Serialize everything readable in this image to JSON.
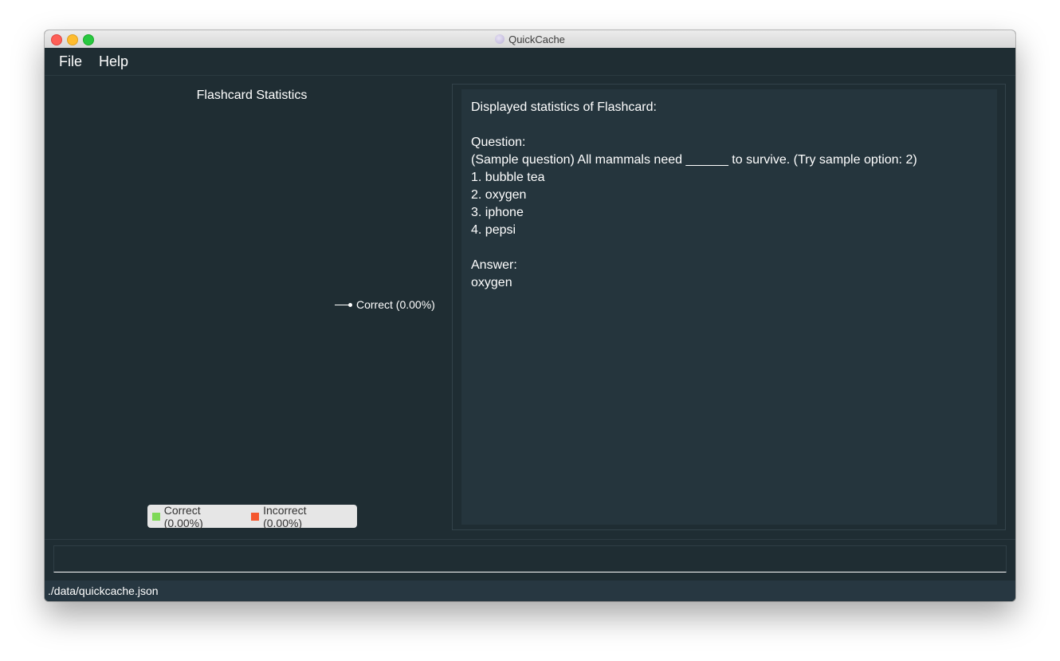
{
  "window": {
    "title": "QuickCache"
  },
  "menu": {
    "items": [
      "File",
      "Help"
    ]
  },
  "stats": {
    "title": "Flashcard Statistics",
    "pie_label": "Correct (0.00%)",
    "legend": [
      {
        "label": "Correct (0.00%)",
        "color": "#7ed957"
      },
      {
        "label": "Incorrect (0.00%)",
        "color": "#f4572e"
      }
    ]
  },
  "flashcard": {
    "heading": "Displayed statistics of Flashcard:",
    "question_label": "Question:",
    "question": "(Sample question) All mammals need ______ to survive. (Try sample option: 2)",
    "options": [
      "1. bubble tea",
      "2. oxygen",
      "3. iphone",
      "4. pepsi"
    ],
    "answer_label": "Answer:",
    "answer": "oxygen"
  },
  "command": {
    "value": "",
    "placeholder": ""
  },
  "status": {
    "path": "./data/quickcache.json"
  }
}
